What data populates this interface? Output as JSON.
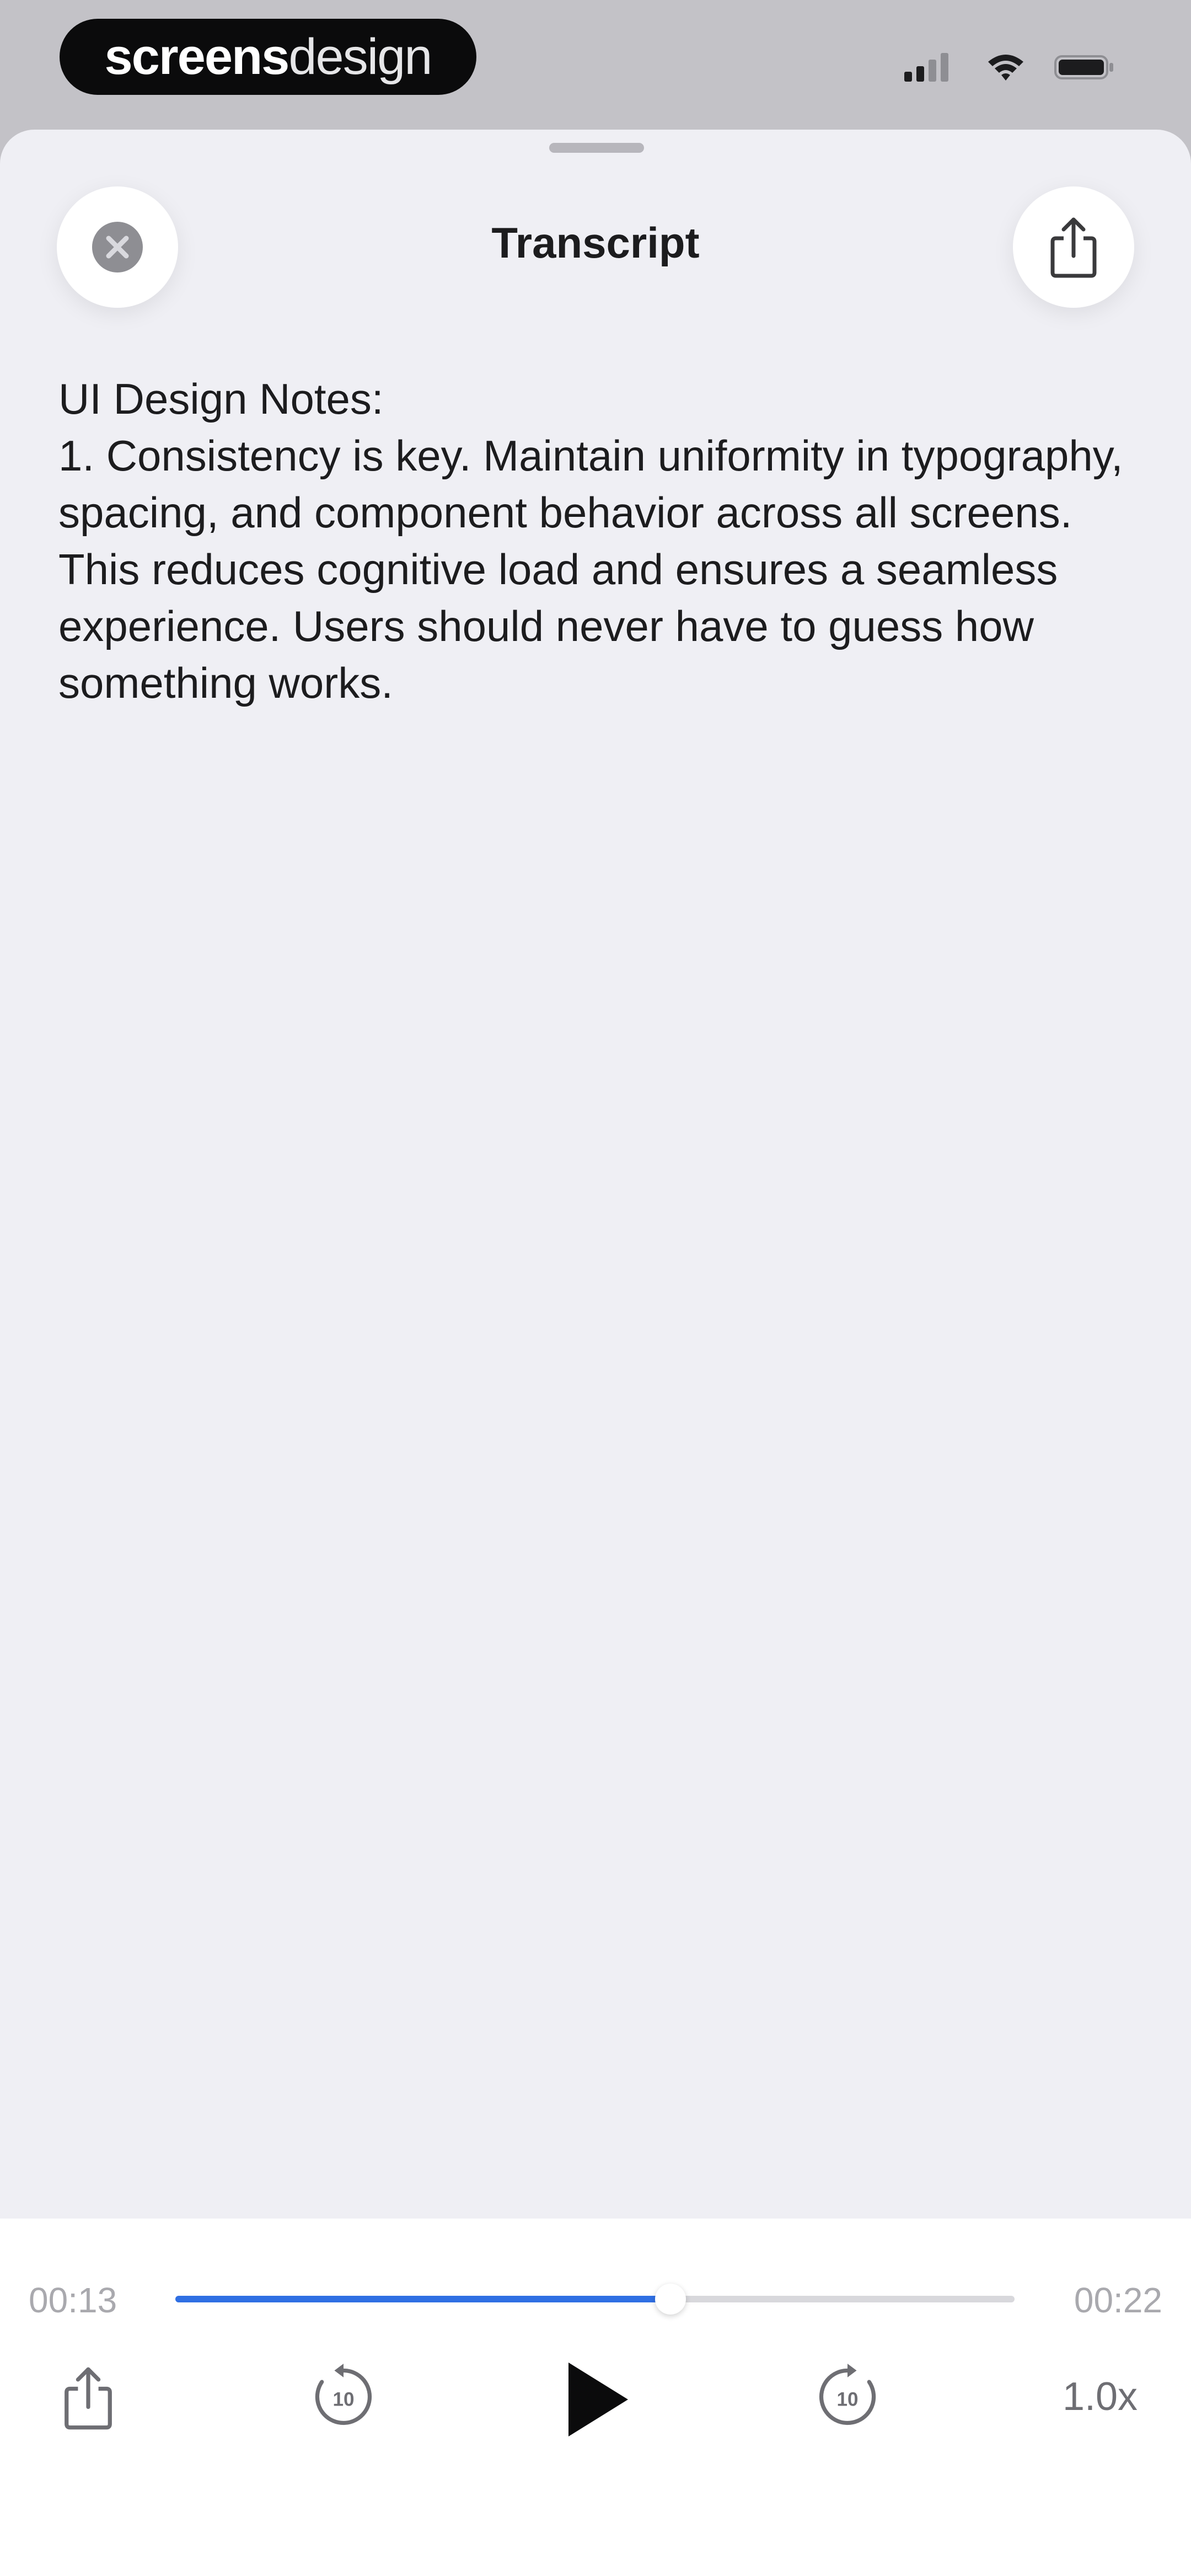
{
  "status_bar": {
    "brand_strong": "screens",
    "brand_light": "design",
    "icons": [
      "cellular-signal-icon",
      "wifi-icon",
      "battery-icon"
    ]
  },
  "sheet": {
    "title": "Transcript",
    "close_icon": "close-icon",
    "share_icon": "share-icon"
  },
  "transcript": {
    "text": "UI Design Notes:\n1. Consistency is key. Maintain uniformity in typography, spacing, and component behavior across all screens. This reduces cognitive load and ensures a seamless experience. Users should never have to guess how something works."
  },
  "player": {
    "current_time": "00:13",
    "total_time": "00:22",
    "progress_percent": 59,
    "speed_label": "1.0x",
    "rewind_seconds": "10",
    "forward_seconds": "10",
    "accent_color": "#2f6fe3",
    "icons": [
      "share-icon",
      "rewind-10-icon",
      "play-icon",
      "forward-10-icon"
    ]
  }
}
